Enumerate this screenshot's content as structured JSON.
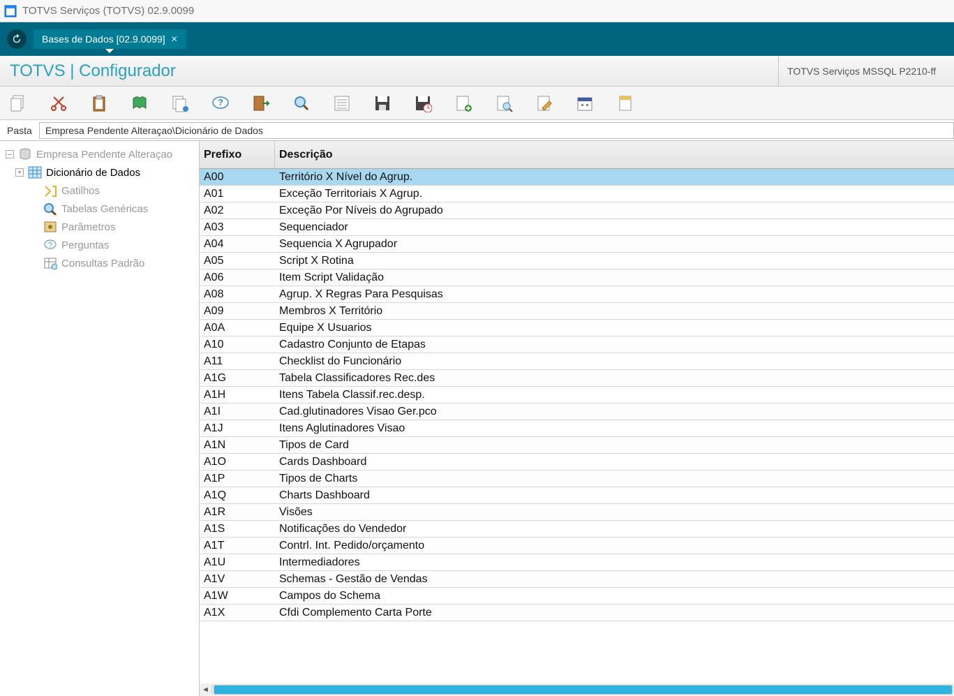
{
  "window": {
    "title": "TOTVS Serviços (TOTVS) 02.9.0099"
  },
  "tab": {
    "label": "Bases de Dados [02.9.0099]"
  },
  "app": {
    "title": "TOTVS | Configurador",
    "env": "TOTVS Serviços MSSQL P2210-ff"
  },
  "pathbar": {
    "label": "Pasta",
    "value": "Empresa Pendente Alteraçao\\Dicionário de Dados"
  },
  "tree": {
    "root": "Empresa Pendente Alteraçao",
    "selected": "Dicionário de Dados",
    "items": [
      {
        "label": "Gatilhos"
      },
      {
        "label": "Tabelas Genéricas"
      },
      {
        "label": "Parâmetros"
      },
      {
        "label": "Perguntas"
      },
      {
        "label": "Consultas Padrão"
      }
    ]
  },
  "grid": {
    "headers": {
      "prefix": "Prefixo",
      "desc": "Descrição"
    },
    "rows": [
      {
        "prefix": "A00",
        "desc": "Território X Nível do Agrup.",
        "selected": true
      },
      {
        "prefix": "A01",
        "desc": "Exceção Territoriais X Agrup."
      },
      {
        "prefix": "A02",
        "desc": "Exceção Por Níveis do Agrupado"
      },
      {
        "prefix": "A03",
        "desc": "Sequenciador"
      },
      {
        "prefix": "A04",
        "desc": "Sequencia X Agrupador"
      },
      {
        "prefix": "A05",
        "desc": "Script X Rotina"
      },
      {
        "prefix": "A06",
        "desc": "Item Script Validação"
      },
      {
        "prefix": "A08",
        "desc": "Agrup. X Regras Para Pesquisas"
      },
      {
        "prefix": "A09",
        "desc": "Membros X Território"
      },
      {
        "prefix": "A0A",
        "desc": "Equipe X Usuarios"
      },
      {
        "prefix": "A10",
        "desc": "Cadastro Conjunto de Etapas"
      },
      {
        "prefix": "A11",
        "desc": "Checklist do Funcionário"
      },
      {
        "prefix": "A1G",
        "desc": "Tabela Classificadores Rec.des"
      },
      {
        "prefix": "A1H",
        "desc": "Itens Tabela Classif.rec.desp."
      },
      {
        "prefix": "A1I",
        "desc": "Cad.glutinadores Visao Ger.pco"
      },
      {
        "prefix": "A1J",
        "desc": "Itens Aglutinadores Visao"
      },
      {
        "prefix": "A1N",
        "desc": "Tipos de Card"
      },
      {
        "prefix": "A1O",
        "desc": "Cards Dashboard"
      },
      {
        "prefix": "A1P",
        "desc": "Tipos de Charts"
      },
      {
        "prefix": "A1Q",
        "desc": "Charts Dashboard"
      },
      {
        "prefix": "A1R",
        "desc": "Visões"
      },
      {
        "prefix": "A1S",
        "desc": "Notificações do Vendedor"
      },
      {
        "prefix": "A1T",
        "desc": "Contrl. Int. Pedido/orçamento"
      },
      {
        "prefix": "A1U",
        "desc": "Intermediadores"
      },
      {
        "prefix": "A1V",
        "desc": "Schemas - Gestão de Vendas"
      },
      {
        "prefix": "A1W",
        "desc": "Campos do Schema"
      },
      {
        "prefix": "A1X",
        "desc": "Cfdi Complemento Carta Porte"
      }
    ]
  }
}
